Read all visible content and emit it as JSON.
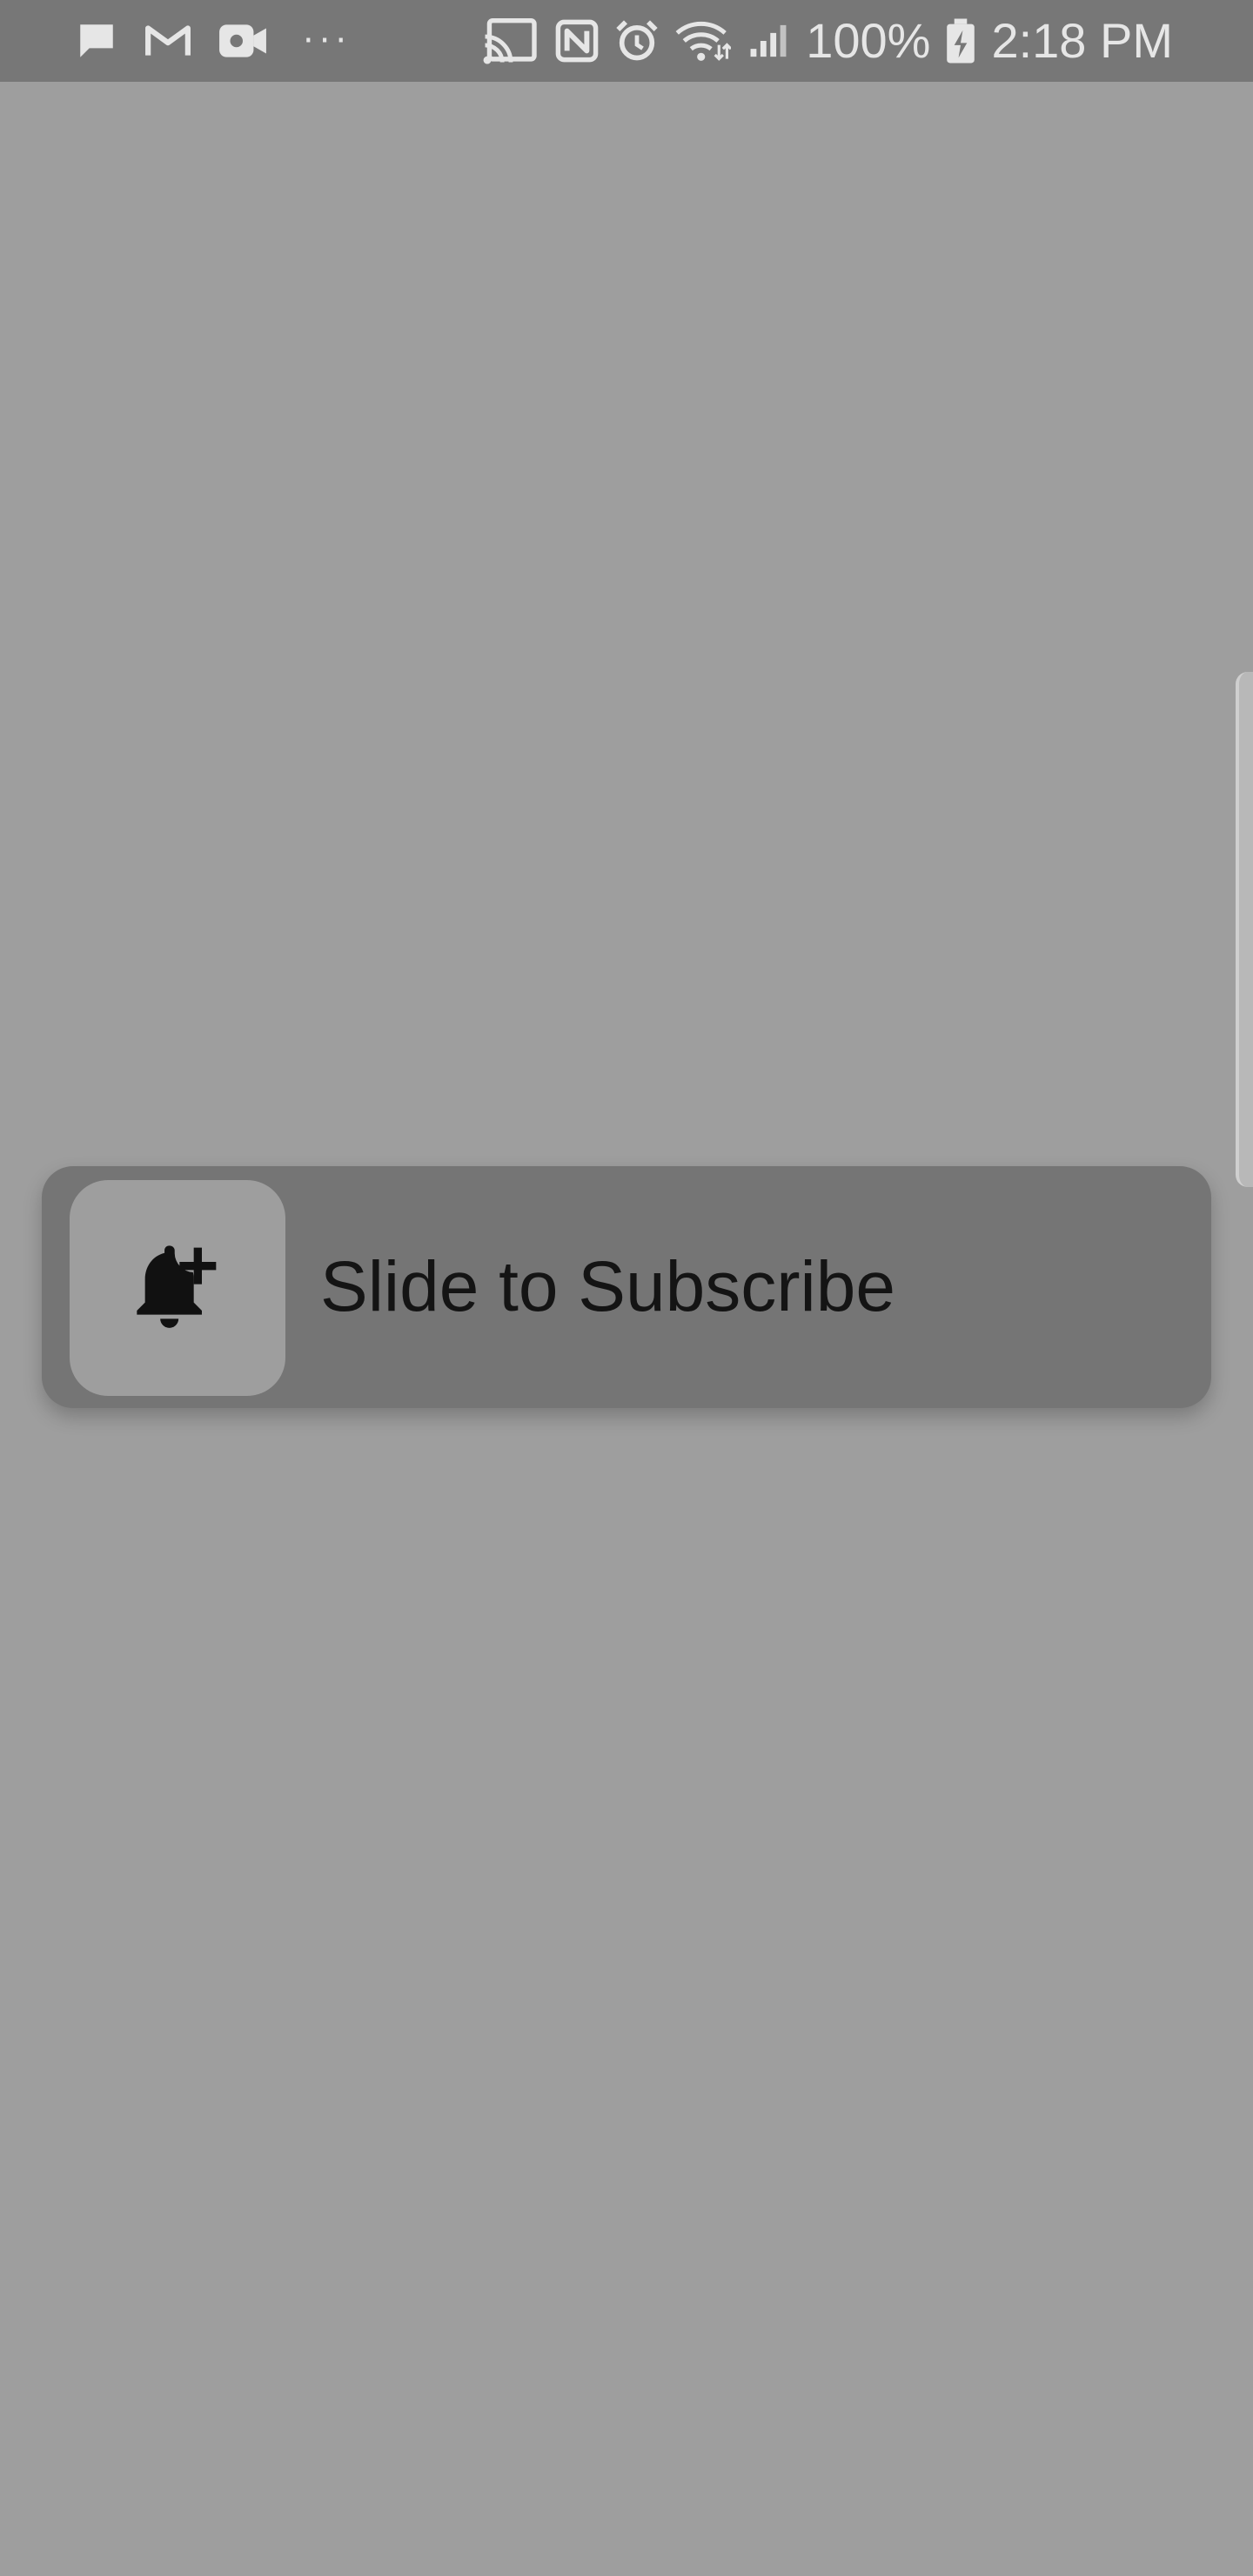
{
  "status_bar": {
    "left_icons": [
      "message-icon",
      "gmail-icon",
      "video-icon"
    ],
    "more_label": "···",
    "right_icons": [
      "cast-icon",
      "nfc-icon",
      "alarm-icon",
      "wifi-icon",
      "signal-icon"
    ],
    "battery_percent": "100%",
    "battery_icon": "battery-charging-icon",
    "time": "2:18 PM"
  },
  "subscribe": {
    "icon": "bell-plus-icon",
    "label": "Slide to Subscribe"
  },
  "colors": {
    "background": "#9e9e9e",
    "status_bar": "#777777",
    "track": "#757575",
    "thumb": "#9e9e9e",
    "label_text": "#141414",
    "status_text": "#e6e6e6"
  }
}
